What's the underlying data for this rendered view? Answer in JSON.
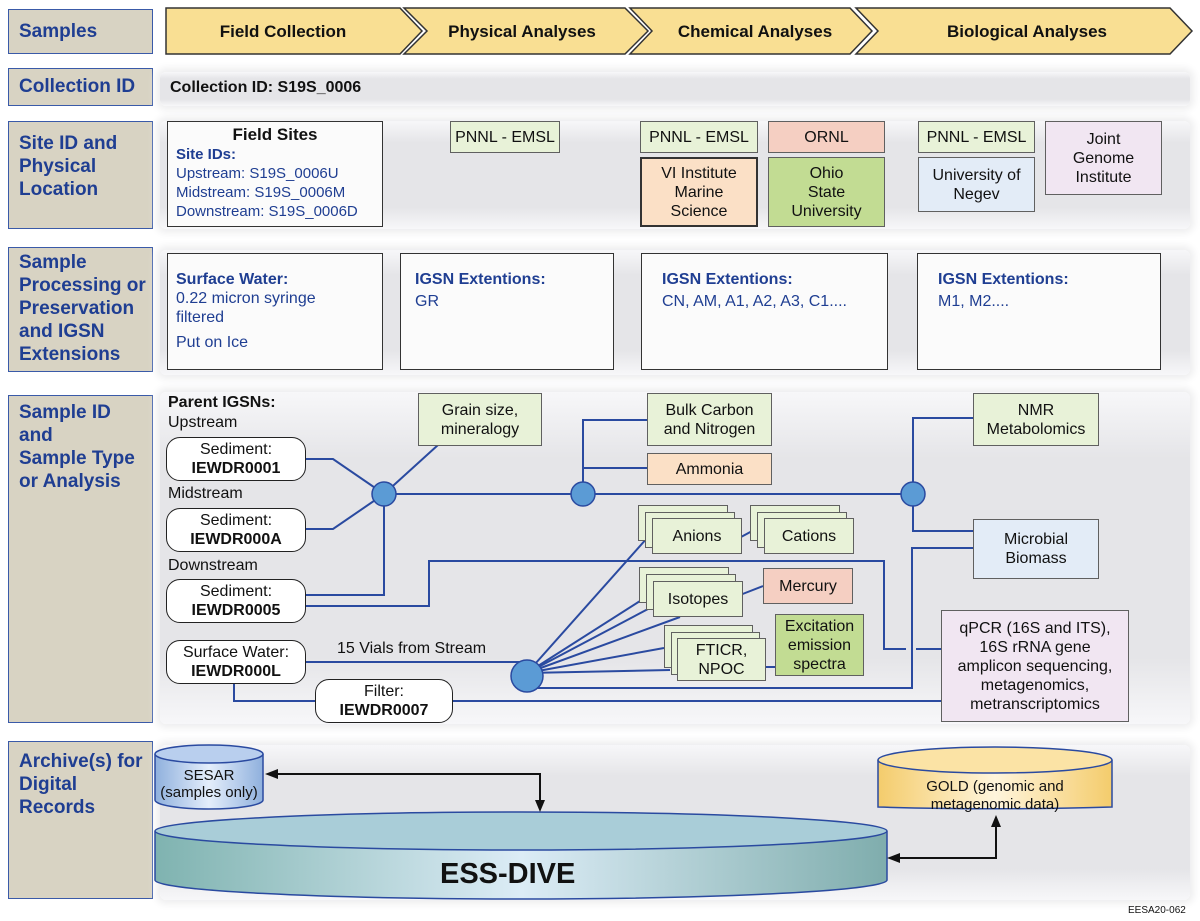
{
  "row_labels": {
    "samples": "Samples",
    "collection_id": "Collection ID",
    "site": [
      "Site ID and",
      "Physical",
      "Location"
    ],
    "processing": [
      "Sample",
      "Processing or",
      "Preservation",
      "and IGSN",
      "Extensions"
    ],
    "sample_id": [
      "Sample ID",
      "and",
      "Sample Type",
      "or Analysis"
    ],
    "archive": [
      "Archive(s) for",
      "Digital",
      "Records"
    ]
  },
  "stages": [
    "Field Collection",
    "Physical Analyses",
    "Chemical Analyses",
    "Biological Analyses"
  ],
  "collection": {
    "text": "Collection ID: S19S_0006"
  },
  "field_sites": {
    "title": "Field Sites",
    "subtitle": "Site IDs:",
    "upstream": "Upstream: S19S_0006U",
    "midstream": "Midstream: S19S_0006M",
    "downstream": "Downstream: S19S_0006D"
  },
  "institutions": {
    "physical": "PNNL - EMSL",
    "chem_pnnl": "PNNL - EMSL",
    "chem_vi": [
      "VI Institute",
      "Marine",
      "Science"
    ],
    "chem_ornl": "ORNL",
    "chem_ohio": [
      "Ohio",
      "State",
      "University"
    ],
    "bio_pnnl": "PNNL - EMSL",
    "bio_negev": [
      "University of",
      "Negev"
    ],
    "bio_jgi": [
      "Joint",
      "Genome",
      "Institute"
    ]
  },
  "processing": {
    "field_title": "Surface Water:",
    "field_line1": "0.22 micron syringe",
    "field_line2": "filtered",
    "field_line3": "Put on Ice",
    "physical_title": "IGSN Extentions:",
    "physical_values": "GR",
    "chemical_title": "IGSN Extentions:",
    "chemical_values": "CN, AM, A1, A2, A3, C1....",
    "biological_title": "IGSN Extentions:",
    "biological_values": "M1, M2...."
  },
  "samples": {
    "parent_label": "Parent IGSNs:",
    "upstream_label": "Upstream",
    "midstream_label": "Midstream",
    "downstream_label": "Downstream",
    "sed_up": {
      "type": "Sediment:",
      "id": "IEWDR0001"
    },
    "sed_mid": {
      "type": "Sediment:",
      "id": "IEWDR000A"
    },
    "sed_down": {
      "type": "Sediment:",
      "id": "IEWDR0005"
    },
    "water": {
      "type": "Surface Water:",
      "id": "IEWDR000L"
    },
    "filter": {
      "type": "Filter:",
      "id": "IEWDR0007"
    },
    "vials_label": "15 Vials from Stream"
  },
  "analyses": {
    "grain": [
      "Grain size,",
      "mineralogy"
    ],
    "bulk": [
      "Bulk Carbon",
      "and Nitrogen"
    ],
    "ammonia": "Ammonia",
    "anions": "Anions",
    "cations": "Cations",
    "isotopes": "Isotopes",
    "mercury": "Mercury",
    "fticr": [
      "FTICR,",
      "NPOC"
    ],
    "excitation": [
      "Excitation",
      "emission",
      "spectra"
    ],
    "nmr": [
      "NMR",
      "Metabolomics"
    ],
    "microbial": [
      "Microbial",
      "Biomass"
    ],
    "qpcr": [
      "qPCR (16S and ITS),",
      "16S rRNA gene",
      "amplicon sequencing,",
      "metagenomics,",
      "metranscriptomics"
    ]
  },
  "archives": {
    "sesar": [
      "SESAR",
      "(samples only)"
    ],
    "essdive": "ESS-DIVE",
    "gold": [
      "GOLD (genomic and",
      "metagenomic data)"
    ]
  },
  "figure_id": "EESA20-062",
  "colors": {
    "label_bg": "#d8d3c3",
    "label_text": "#1f3e92",
    "stage_fill": "#f9df93",
    "connector": "#2a4aa0",
    "node_fill": "#5b9bd5"
  }
}
